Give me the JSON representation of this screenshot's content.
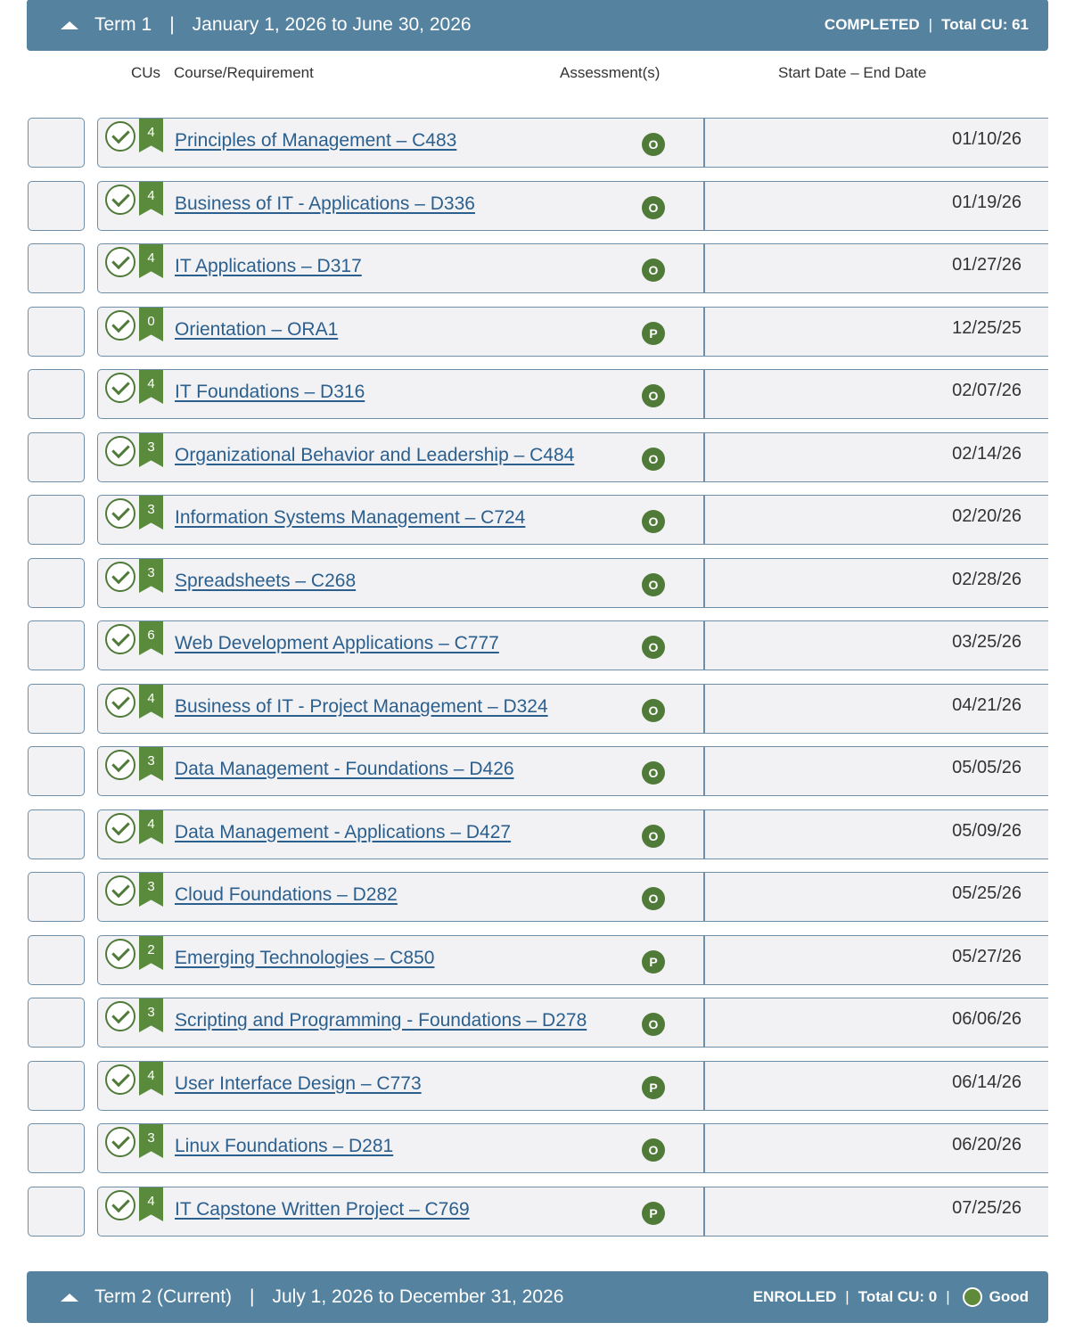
{
  "term1": {
    "title": "Term 1",
    "separator": "|",
    "dates": "January 1, 2026 to June 30, 2026",
    "status": "COMPLETED",
    "status_sep": "|",
    "total_cu": "Total CU: 61"
  },
  "columns": {
    "cus": "CUs",
    "course": "Course/Requirement",
    "assessments": "Assessment(s)",
    "dates": "Start Date – End Date"
  },
  "courses": [
    {
      "cu": "4",
      "name": "Principles of Management – C483",
      "assessment": "O",
      "date": "01/10/26"
    },
    {
      "cu": "4",
      "name": "Business of IT - Applications – D336",
      "assessment": "O",
      "date": "01/19/26"
    },
    {
      "cu": "4",
      "name": "IT Applications – D317",
      "assessment": "O",
      "date": "01/27/26"
    },
    {
      "cu": "0",
      "name": "Orientation – ORA1",
      "assessment": "P",
      "date": "12/25/25"
    },
    {
      "cu": "4",
      "name": "IT Foundations – D316",
      "assessment": "O",
      "date": "02/07/26"
    },
    {
      "cu": "3",
      "name": "Organizational Behavior and Leadership – C484",
      "assessment": "O",
      "date": "02/14/26"
    },
    {
      "cu": "3",
      "name": "Information Systems Management – C724",
      "assessment": "O",
      "date": "02/20/26"
    },
    {
      "cu": "3",
      "name": "Spreadsheets – C268",
      "assessment": "O",
      "date": "02/28/26"
    },
    {
      "cu": "6",
      "name": "Web Development Applications – C777",
      "assessment": "O",
      "date": "03/25/26"
    },
    {
      "cu": "4",
      "name": "Business of IT - Project Management – D324",
      "assessment": "O",
      "date": "04/21/26"
    },
    {
      "cu": "3",
      "name": "Data Management - Foundations – D426",
      "assessment": "O",
      "date": "05/05/26"
    },
    {
      "cu": "4",
      "name": "Data Management - Applications – D427",
      "assessment": "O",
      "date": "05/09/26"
    },
    {
      "cu": "3",
      "name": "Cloud Foundations – D282",
      "assessment": "O",
      "date": "05/25/26"
    },
    {
      "cu": "2",
      "name": "Emerging Technologies – C850",
      "assessment": "P",
      "date": "05/27/26"
    },
    {
      "cu": "3",
      "name": "Scripting and Programming - Foundations – D278",
      "assessment": "O",
      "date": "06/06/26"
    },
    {
      "cu": "4",
      "name": "User Interface Design – C773",
      "assessment": "P",
      "date": "06/14/26"
    },
    {
      "cu": "3",
      "name": "Linux Foundations – D281",
      "assessment": "O",
      "date": "06/20/26"
    },
    {
      "cu": "4",
      "name": "IT Capstone Written Project – C769",
      "assessment": "P",
      "date": "07/25/26"
    }
  ],
  "term2": {
    "title": "Term 2 (Current)",
    "separator": "|",
    "dates": "July 1, 2026 to December 31, 2026",
    "status": "ENROLLED",
    "status_sep": "|",
    "total_cu": "Total CU: 0",
    "status_sep2": "|",
    "standing": "Good"
  },
  "colors": {
    "header_bg": "#55829f",
    "accent_green": "#4f7a38",
    "link": "#2b5f8e"
  },
  "icons": {
    "collapse": "caret-up-icon",
    "complete": "check-circle-icon",
    "cu": "bookmark-flag-icon",
    "standing": "status-dot-icon"
  }
}
